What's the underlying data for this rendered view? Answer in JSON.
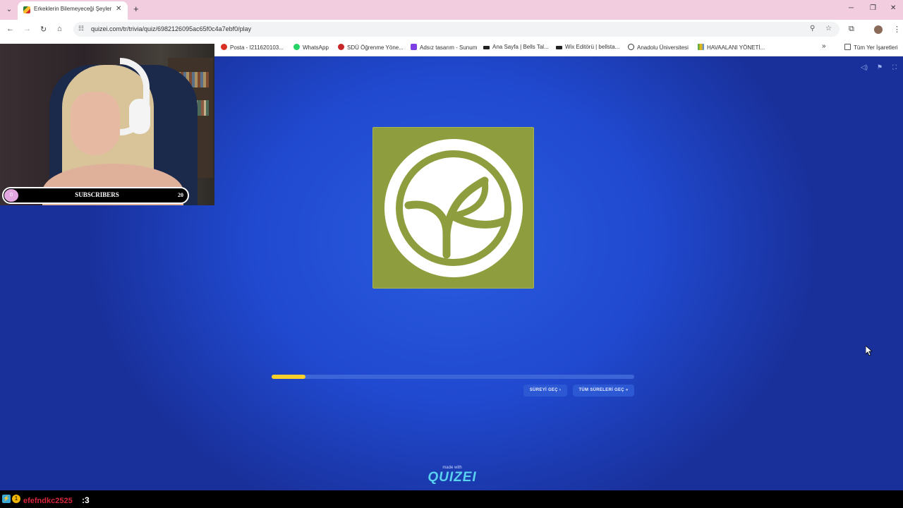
{
  "browser": {
    "tab_title": "Erkeklerin Bilemeyeceği Şeyler",
    "url": "quizei.com/tr/trivia/quiz/6982126095ac65f0c4a7ebf0/play",
    "bookmarks": [
      {
        "label": "Posta - I211620103...",
        "color": "#d93025"
      },
      {
        "label": "WhatsApp",
        "color": "#25d366"
      },
      {
        "label": "SDÜ Öğrenme Yöne...",
        "color": "#c62828"
      },
      {
        "label": "Adsız tasarım - Sunum",
        "color": "#7b3fe4"
      },
      {
        "label": "Ana Sayfa | Bells Tal...",
        "color": "#222222"
      },
      {
        "label": "Wix Editörü | bellsta...",
        "color": "#222222"
      },
      {
        "label": "Anadolu Üniversitesi",
        "color": "#333333"
      },
      {
        "label": "HAVAALANI YÖNETİ...",
        "color": "#fbbc04"
      }
    ],
    "all_bookmarks_label": "Tüm Yer İşaretleri"
  },
  "quiz": {
    "progress_fraction": 0.094,
    "skip_label": "SÜREYİ GEÇ ›",
    "skip_all_label": "TÜM SÜRELERİ GEÇ »",
    "made_with": "made with",
    "brand": "QUIZEI",
    "logo_bg_color": "#8e9e3f"
  },
  "overlay": {
    "sub_current": "0",
    "sub_label": "SUBSCRIBERS",
    "sub_goal": "20"
  },
  "chat": {
    "username": "efefndkc2525",
    "message": ":3"
  }
}
